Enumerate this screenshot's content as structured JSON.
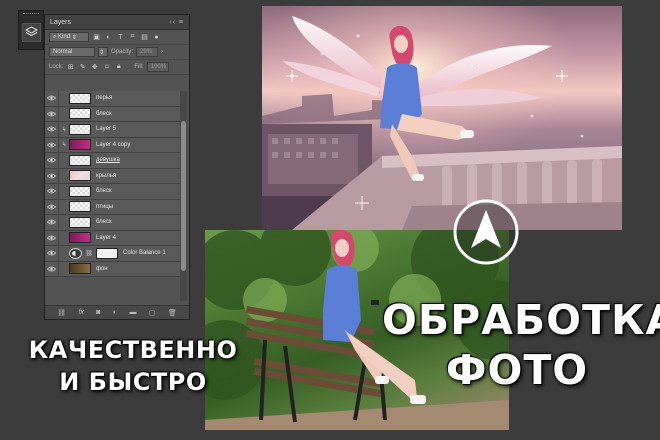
{
  "layers_panel": {
    "tab_title": "Layers",
    "tab_controls": "‹‹  ≡",
    "filter_label": "Kind",
    "blend_mode": "Normal",
    "opacity_label": "Opacity:",
    "opacity_value": "29%",
    "lock_label": "Lock:",
    "fill_label": "Fill:",
    "fill_value": "100%",
    "layers": [
      {
        "name": "перья",
        "thumb": "checker",
        "linked": false,
        "selected": false,
        "underline": false
      },
      {
        "name": "блеск",
        "thumb": "checker",
        "linked": false,
        "selected": false,
        "underline": false
      },
      {
        "name": "Layer 5",
        "thumb": "checker",
        "linked": true,
        "selected": false,
        "underline": false
      },
      {
        "name": "Layer 4 copy",
        "thumb": "magenta",
        "linked": true,
        "selected": false,
        "underline": false
      },
      {
        "name": "девушка",
        "thumb": "checker",
        "linked": false,
        "selected": false,
        "underline": true
      },
      {
        "name": "крылья",
        "thumb": "girl",
        "linked": false,
        "selected": false,
        "underline": false
      },
      {
        "name": "блеск",
        "thumb": "checker",
        "linked": false,
        "selected": false,
        "underline": false
      },
      {
        "name": "птицы",
        "thumb": "checker",
        "linked": false,
        "selected": false,
        "underline": false
      },
      {
        "name": "блеск",
        "thumb": "checker",
        "linked": false,
        "selected": false,
        "underline": false
      },
      {
        "name": "Layer 4",
        "thumb": "magenta",
        "linked": false,
        "selected": false,
        "underline": false
      },
      {
        "name": "Color Balance 1",
        "thumb": "adjustment",
        "linked": false,
        "selected": false,
        "underline": false
      },
      {
        "name": "фон",
        "thumb": "dark",
        "linked": false,
        "selected": false,
        "underline": false
      }
    ],
    "footer_icons": [
      "link-icon",
      "fx-icon",
      "mask-icon",
      "adjustment-icon",
      "folder-icon",
      "new-layer-icon",
      "trash-icon"
    ]
  },
  "headline": {
    "left_line1": "КАЧЕСТВЕННО",
    "left_line2": "И БЫСТРО",
    "right_line1": "ОБРАБОТКА",
    "right_line2": "ФОТО"
  },
  "colors": {
    "background": "#3c3c3c",
    "panel": "#535353",
    "text": "#ffffff",
    "dress": "#5b7fd6",
    "hair": "#d94d72"
  }
}
